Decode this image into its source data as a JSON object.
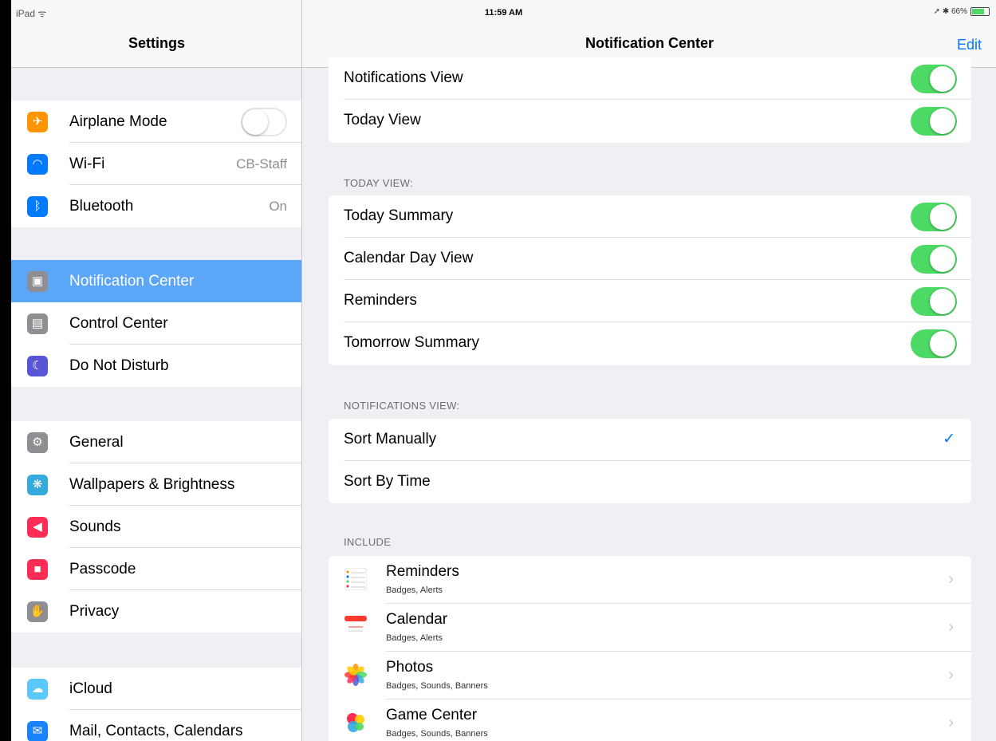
{
  "status_bar": {
    "carrier": "iPad ᯤ",
    "time": "11:59 AM",
    "battery_text": "➚ ✱ 66%",
    "battery_level": 0.66
  },
  "sidebar": {
    "title": "Settings",
    "groups": [
      {
        "items": [
          {
            "label": "Airplane Mode",
            "icon": "airplane-icon",
            "color": "#ff9500",
            "glyph": "✈",
            "toggle": "off"
          },
          {
            "label": "Wi-Fi",
            "icon": "wifi-icon",
            "color": "#007aff",
            "glyph": "◠",
            "value": "CB-Staff"
          },
          {
            "label": "Bluetooth",
            "icon": "bluetooth-icon",
            "color": "#007aff",
            "glyph": "ᛒ",
            "value": "On"
          }
        ]
      },
      {
        "items": [
          {
            "label": "Notification Center",
            "icon": "notification-center-icon",
            "color": "#8e8e93",
            "glyph": "▣",
            "selected": true
          },
          {
            "label": "Control Center",
            "icon": "control-center-icon",
            "color": "#8e8e93",
            "glyph": "▤"
          },
          {
            "label": "Do Not Disturb",
            "icon": "moon-icon",
            "color": "#5856d6",
            "glyph": "☾"
          }
        ]
      },
      {
        "items": [
          {
            "label": "General",
            "icon": "gear-icon",
            "color": "#8e8e93",
            "glyph": "⚙"
          },
          {
            "label": "Wallpapers & Brightness",
            "icon": "wallpaper-icon",
            "color": "#34aadc",
            "glyph": "❋"
          },
          {
            "label": "Sounds",
            "icon": "speaker-icon",
            "color": "#ff2d55",
            "glyph": "◀"
          },
          {
            "label": "Passcode",
            "icon": "lock-icon",
            "color": "#ff2d55",
            "glyph": "■"
          },
          {
            "label": "Privacy",
            "icon": "hand-icon",
            "color": "#8e8e93",
            "glyph": "✋"
          }
        ]
      },
      {
        "items": [
          {
            "label": "iCloud",
            "icon": "cloud-icon",
            "color": "#5ac8fa",
            "glyph": "☁"
          },
          {
            "label": "Mail, Contacts, Calendars",
            "icon": "mail-icon",
            "color": "#1a82fb",
            "glyph": "✉"
          }
        ]
      }
    ]
  },
  "detail": {
    "title": "Notification Center",
    "edit_label": "Edit",
    "access_rows": [
      {
        "label": "Notifications View",
        "toggle": "on"
      },
      {
        "label": "Today View",
        "toggle": "on"
      }
    ],
    "today_view": {
      "header": "TODAY VIEW:",
      "rows": [
        {
          "label": "Today Summary",
          "toggle": "on"
        },
        {
          "label": "Calendar Day View",
          "toggle": "on"
        },
        {
          "label": "Reminders",
          "toggle": "on"
        },
        {
          "label": "Tomorrow Summary",
          "toggle": "on"
        }
      ]
    },
    "notifications_view": {
      "header": "NOTIFICATIONS VIEW:",
      "rows": [
        {
          "label": "Sort Manually",
          "checked": true
        },
        {
          "label": "Sort By Time",
          "checked": false
        }
      ],
      "check_glyph": "✓"
    },
    "include": {
      "header": "INCLUDE",
      "apps": [
        {
          "name": "Reminders",
          "sub": "Badges, Alerts",
          "icon": "reminders-icon"
        },
        {
          "name": "Calendar",
          "sub": "Badges, Alerts",
          "icon": "calendar-icon"
        },
        {
          "name": "Photos",
          "sub": "Badges, Sounds, Banners",
          "icon": "photos-icon"
        },
        {
          "name": "Game Center",
          "sub": "Badges, Sounds, Banners",
          "icon": "game-center-icon"
        }
      ],
      "chevron_glyph": "›"
    }
  }
}
